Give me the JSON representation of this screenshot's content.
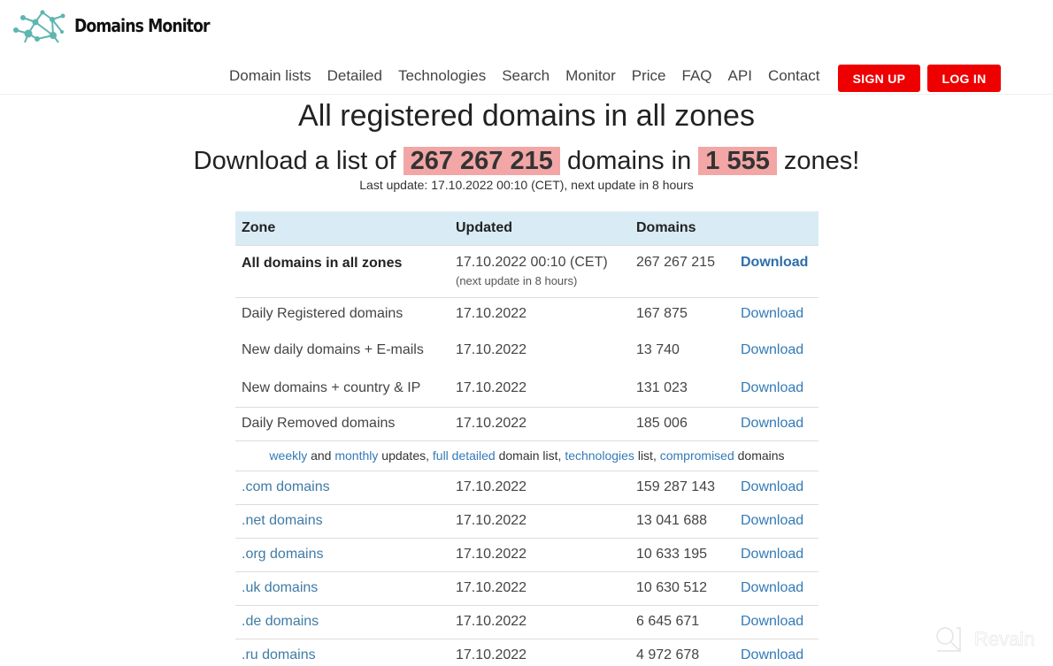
{
  "header": {
    "logo_text": "Domains Monitor",
    "nav": [
      "Domain lists",
      "Detailed",
      "Technologies",
      "Search",
      "Monitor",
      "Price",
      "FAQ",
      "API",
      "Contact"
    ],
    "signup_label": "SIGN UP",
    "login_label": "LOG IN",
    "accent_color": "#ee0000"
  },
  "hero": {
    "title": "All registered domains in all zones",
    "sub_prefix": "Download a list of",
    "total_domains": "267 267 215",
    "sub_middle": "domains in",
    "total_zones": "1 555",
    "sub_suffix": "zones!",
    "last_update": "Last update: 17.10.2022 00:10 (CET), next update in 8 hours"
  },
  "table": {
    "headers": [
      "Zone",
      "Updated",
      "Domains",
      ""
    ],
    "featured": {
      "zone": "All domains in all zones",
      "updated": "17.10.2022 00:10 (CET)",
      "updated_note": "(next update in 8 hours)",
      "domains": "267 267 215",
      "action": "Download"
    },
    "daily_rows": [
      {
        "zone": "Daily Registered domains",
        "updated": "17.10.2022",
        "domains": "167 875",
        "action": "Download"
      },
      {
        "zone": "New daily domains + E-mails",
        "updated": "17.10.2022",
        "domains": "13 740",
        "action": "Download"
      },
      {
        "zone": "New domains + country & IP",
        "updated": "17.10.2022",
        "domains": "131 023",
        "action": "Download"
      },
      {
        "zone": "Daily Removed domains",
        "updated": "17.10.2022",
        "domains": "185 006",
        "action": "Download"
      }
    ],
    "links_line": {
      "weekly": "weekly",
      "and": " and ",
      "monthly": "monthly",
      "updates": " updates, ",
      "full_detailed": "full detailed",
      "domain_list": " domain list, ",
      "technologies": "technologies",
      "list": " list, ",
      "compromised": "compromised",
      "domains": " domains"
    },
    "zone_rows": [
      {
        "zone": ".com domains",
        "updated": "17.10.2022",
        "domains": "159 287 143",
        "action": "Download"
      },
      {
        "zone": ".net domains",
        "updated": "17.10.2022",
        "domains": "13 041 688",
        "action": "Download"
      },
      {
        "zone": ".org domains",
        "updated": "17.10.2022",
        "domains": "10 633 195",
        "action": "Download"
      },
      {
        "zone": ".uk domains",
        "updated": "17.10.2022",
        "domains": "10 630 512",
        "action": "Download"
      },
      {
        "zone": ".de domains",
        "updated": "17.10.2022",
        "domains": "6 645 671",
        "action": "Download"
      },
      {
        "zone": ".ru domains",
        "updated": "17.10.2022",
        "domains": "4 972 678",
        "action": "Download"
      }
    ]
  },
  "watermark": {
    "text": "Revain"
  }
}
